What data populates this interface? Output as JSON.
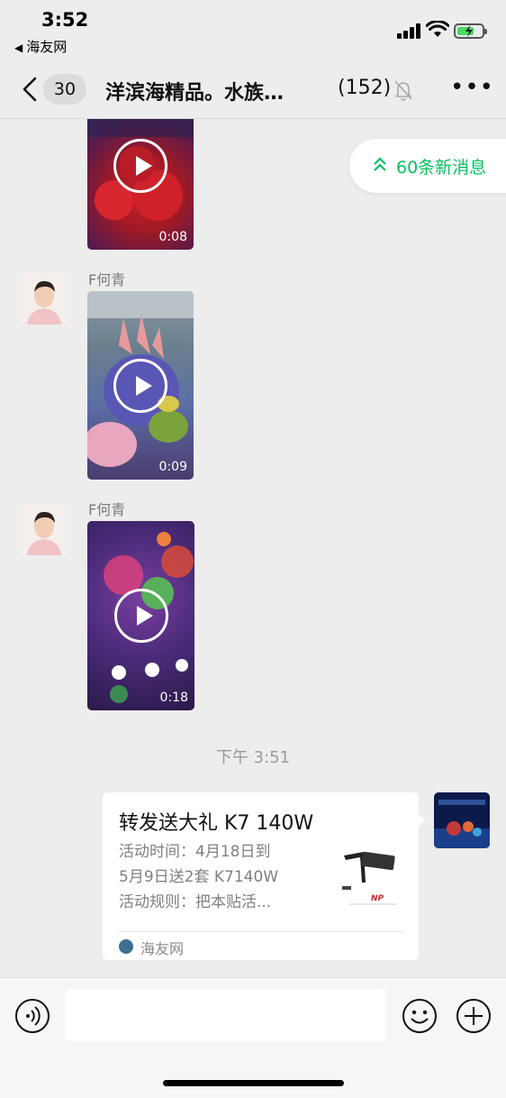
{
  "status_bar": {
    "time": "3:52",
    "back_app": "海友网",
    "back_app_icon": "back-triangle-icon"
  },
  "nav": {
    "unread_count": "30",
    "title": "洋滨海精品。水族…",
    "member_count": "(152)",
    "icons": [
      "back-chevron-icon",
      "mute-bell-icon",
      "more-icon"
    ]
  },
  "new_messages": {
    "label": "60条新消息",
    "color": "#07c160"
  },
  "messages": [
    {
      "type": "video",
      "sender": "",
      "duration": "0:08"
    },
    {
      "type": "video",
      "sender": "F何青",
      "duration": "0:09"
    },
    {
      "type": "video",
      "sender": "F何青",
      "duration": "0:18"
    }
  ],
  "timestamp": "下午 3:51",
  "link_card": {
    "title": "转发送大礼 K7 140W",
    "desc_lines": [
      "活动时间：4月18日到",
      "5月9日送2套 K7140W",
      "活动规则：把本贴活..."
    ],
    "source": "海友网"
  },
  "input_bar": {
    "placeholder": "",
    "icons": [
      "voice-icon",
      "emoji-icon",
      "plus-icon"
    ]
  },
  "colors": {
    "accent": "#07c160",
    "background": "#ededed"
  }
}
